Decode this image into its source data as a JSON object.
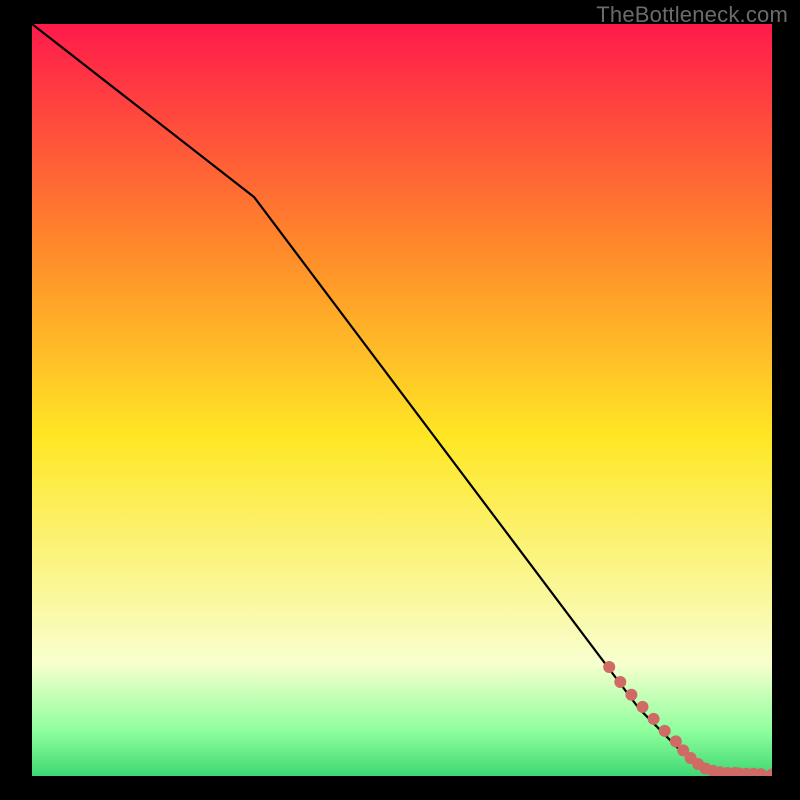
{
  "watermark": "TheBottleneck.com",
  "colors": {
    "background": "#000000",
    "line": "#000000",
    "marker": "#d06a64",
    "grad_top": "#ff1a4b",
    "grad_mid1": "#ff8a2a",
    "grad_mid2": "#ffe725",
    "grad_bottom1": "#f8ffcf",
    "grad_bottom2": "#8eff9d",
    "grad_bottom3": "#3fd873"
  },
  "chart_data": {
    "type": "line",
    "xlim": [
      0,
      100
    ],
    "ylim": [
      0,
      100
    ],
    "title": "",
    "xlabel": "",
    "ylabel": "",
    "series": [
      {
        "name": "curve",
        "x": [
          0,
          30,
          82,
          88,
          92,
          95,
          97,
          99,
          100
        ],
        "y": [
          100,
          77,
          9,
          3,
          1,
          0.5,
          0.3,
          0.2,
          0.2
        ]
      }
    ],
    "markers": {
      "name": "highlight-points",
      "x": [
        78,
        79.5,
        81,
        82.5,
        84,
        85.5,
        87,
        88,
        89,
        90,
        91,
        92,
        93,
        94,
        95,
        95.5,
        96.5,
        97.5,
        98.5,
        100
      ],
      "y": [
        14.5,
        12.5,
        10.8,
        9.2,
        7.6,
        6.0,
        4.6,
        3.4,
        2.4,
        1.6,
        1.0,
        0.7,
        0.5,
        0.4,
        0.4,
        0.35,
        0.3,
        0.3,
        0.25,
        0.2
      ]
    }
  }
}
